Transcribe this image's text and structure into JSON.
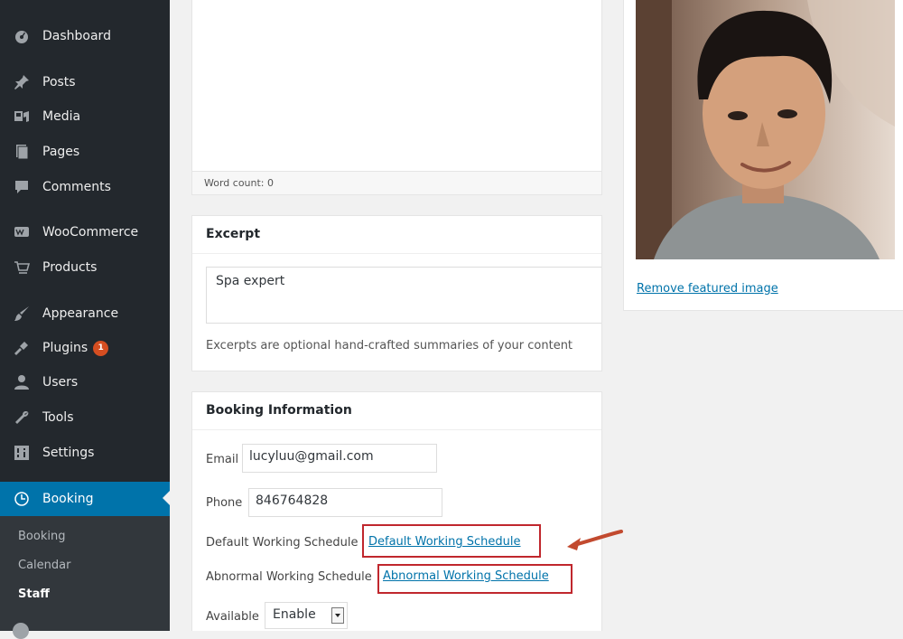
{
  "sidebar": {
    "items": [
      {
        "label": "Dashboard",
        "icon": "dashboard-icon"
      },
      {
        "label": "Posts",
        "icon": "pin-icon"
      },
      {
        "label": "Media",
        "icon": "media-icon"
      },
      {
        "label": "Pages",
        "icon": "pages-icon"
      },
      {
        "label": "Comments",
        "icon": "comment-icon"
      },
      {
        "label": "WooCommerce",
        "icon": "woocommerce-icon"
      },
      {
        "label": "Products",
        "icon": "cart-icon"
      },
      {
        "label": "Appearance",
        "icon": "brush-icon"
      },
      {
        "label": "Plugins",
        "icon": "plugin-icon",
        "badge": "1"
      },
      {
        "label": "Users",
        "icon": "user-icon"
      },
      {
        "label": "Tools",
        "icon": "wrench-icon"
      },
      {
        "label": "Settings",
        "icon": "settings-icon"
      },
      {
        "label": "Booking",
        "icon": "clock-icon"
      }
    ],
    "submenu": [
      "Booking",
      "Calendar",
      "Staff"
    ]
  },
  "editor": {
    "word_count": "Word count: 0"
  },
  "excerpt": {
    "title": "Excerpt",
    "value": "Spa expert",
    "description": "Excerpts are optional hand-crafted summaries of your content"
  },
  "booking": {
    "title": "Booking Information",
    "email_label": "Email",
    "email_value": "lucyluu@gmail.com",
    "phone_label": "Phone",
    "phone_value": "846764828",
    "default_label": "Default Working Schedule",
    "default_link": "Default Working Schedule",
    "abnormal_label": "Abnormal Working Schedule",
    "abnormal_link": "Abnormal Working Schedule",
    "available_label": "Available",
    "available_value": "Enable"
  },
  "featured": {
    "remove_link": "Remove featured image"
  },
  "colors": {
    "sidebar_bg": "#23282d",
    "active_bg": "#0073aa",
    "link": "#0073aa",
    "highlight_red": "#c0272d",
    "badge": "#d54e21"
  }
}
